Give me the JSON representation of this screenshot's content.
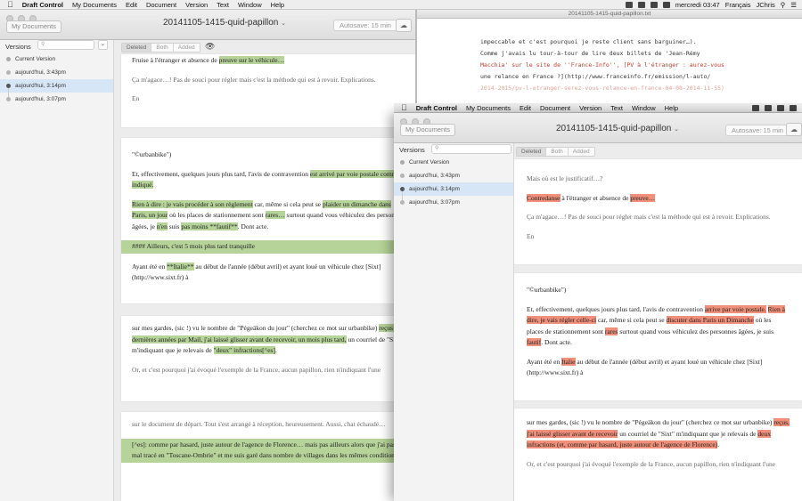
{
  "menubar": {
    "app_name": "Draft Control",
    "items": [
      "My Documents",
      "Edit",
      "Document",
      "Version",
      "Text",
      "Window",
      "Help"
    ],
    "clock": "mercredi 03:47",
    "lang": "Français",
    "user": "JChris"
  },
  "back_window": {
    "toolbar": {
      "my_documents": "My Documents",
      "title": "20141105-1415-quid-papillon",
      "autosave": "Autosave: 15 min"
    },
    "sidebar": {
      "label": "Versions",
      "filter_icon": "chevron-down-icon",
      "items": [
        {
          "label": "Current Version"
        },
        {
          "label": "aujourd'hui, 3:43pm"
        },
        {
          "label": "aujourd'hui, 3:14pm"
        },
        {
          "label": "aujourd'hui, 3:07pm"
        }
      ]
    },
    "segments": [
      "Deleted",
      "Both",
      "Added"
    ],
    "cards": [
      {
        "p1_pre": "Fruise à l'étranger et absence de ",
        "p1_hl": "preuve sur le véhicule…",
        "p2": "Ça m'agace…! Pas de souci pour régler mais c'est la méthode qui est à revoir. Explications.",
        "p3": "En"
      },
      {
        "p1": "\"©urbanbike\")",
        "p2_pre": "Et, effectivement, quelques jours plus tard, l'avis de contravention ",
        "p2_hl": "est arrivé par voie postale comme indiqué.",
        "p3_hl1": "Rien à dire : je vais procéder à son règlement",
        "p3_mid1": " car, même si cela peut se ",
        "p3_hl2": "plaider un dimanche dans Paris, un jour",
        "p3_mid2": " où les places de stationnement sont ",
        "p3_hl3": "rares…",
        "p3_mid3": " surtout quand vous véhiculez des personnes âgées, je ",
        "p3_hl4": "n'en",
        "p3_mid4": " suis ",
        "p3_hl5": "pas moins **fautif**",
        "p3_end": ". Dont acte.",
        "heading": "#### Ailleurs, c'est 5 mois plus tard tranquille",
        "p4_pre": "Ayant été en ",
        "p4_hl": "**Italie**",
        "p4_end": " au début de l'année (début avril) et ayant loué un véhicule chez [Sixt](http://www.sixt.fr) à"
      },
      {
        "p1_pre": "sur mes gardes, (sic !) vu le nombre de \"Pégeäkon du jour\" (cherchez ce mot sur urbanbike) ",
        "p1_hl1": "reçus ces dernières années par Mail, j'ai laissé glisser avant de recevoir, un mois plus tard,",
        "p1_mid": " un courriel de \"Sixt\" m'indiquant que je relevais de ",
        "p1_hl2": "\"deux\" infractions[^es]",
        "p1_end": ".",
        "p2": "Or, et c'est pourquoi j'ai évoqué l'exemple de la France, aucun papillon, rien n'indiquant l'une"
      },
      {
        "p1": "sur le document de départ. Tout s'est arrangé à réception, heureusement. Aussi, chat échaudé…",
        "p2": "[^es]: comme par hasard, juste autour de l'agence de Florence… mais pas ailleurs alors que j'ai pas mal tracé en \"Toscane-Ombrie\" et me suis garé dans nombre de villages dans les mêmes conditions…"
      }
    ]
  },
  "text_window": {
    "title": "20141105-1415-quid-papillon.txt",
    "lines": [
      {
        "text": "impeccable et c'est pourquoi je reste client sans barguiner…)."
      },
      {
        "text": ""
      },
      {
        "text": "Comme j'avais lu tour-à-tour de lire deux billets de 'Jean-Rémy"
      },
      {
        "text": "Macchia' sur le site de ''France-Info'', [PV à l'étranger : aurez-vous"
      },
      {
        "text": "une relance en France ?](http://www.franceinfo.fr/emission/l-auto/"
      },
      {
        "text": "2014-2015/pv-l-etranger-serez-vous-relance-en-france-04-08-2014-11-55)"
      }
    ]
  },
  "front_window": {
    "toolbar": {
      "my_documents": "My Documents",
      "title": "20141105-1415-quid-papillon",
      "autosave": "Autosave: 15 min"
    },
    "sidebar": {
      "label": "Versions",
      "items": [
        {
          "label": "Current Version"
        },
        {
          "label": "aujourd'hui, 3:43pm"
        },
        {
          "label": "aujourd'hui, 3:14pm"
        },
        {
          "label": "aujourd'hui, 3:07pm"
        }
      ]
    },
    "segments": [
      "Deleted",
      "Both",
      "Added"
    ],
    "cards": [
      {
        "p0": "Mais où est le justificatif…?",
        "p1_hl1": "Contredanse",
        "p1_mid": " à l'étranger et absence de ",
        "p1_hl2": "preuve…",
        "p2": "Ça m'agace…! Pas de souci pour régler mais c'est la méthode qui est à revoir. Explications.",
        "p3": "En"
      },
      {
        "p1": "\"©urbanbike\")",
        "p2_pre": "Et, effectivement, quelques jours plus tard, l'avis de contravention ",
        "p2_hl1": "arrive par voie postale.",
        "p2_hl2": "Rien à dire, je vais régler celle-ci",
        "p2_mid1": " car, même si cela peut se ",
        "p2_hl3": "discuter dans Paris un Dimanche",
        "p2_mid2": " où les places de stationnement sont ",
        "p2_hl4": "rares",
        "p2_mid3": " surtout quand vous véhiculez des personnes âgées, je suis ",
        "p2_hl5": "fautif",
        "p2_end": ". Dont acte.",
        "p3_pre": "Ayant été en ",
        "p3_hl": "Italie",
        "p3_end": " au début de l'année (début avril) et ayant loué un véhicule chez [Sixt](http://www.sixt.fr) à"
      },
      {
        "p1_pre": "sur mes gardes, (sic !) vu le nombre de \"Pégeäkon du jour\" (cherchez ce mot sur urbanbike) ",
        "p1_hl1": "reçus, j'ai laissé glisser avant de recevoir",
        "p1_mid": " un courriel de \"Sixt\" m'indiquant que je relevais de ",
        "p1_hl2": "deux infractions (et, comme par hasard, juste autour de l'agence de Florence)",
        "p1_end": ".",
        "p2": "Or, et c'est pourquoi j'ai évoqué l'exemple de la France, aucun papillon, rien n'indiquant l'une"
      }
    ]
  },
  "icons": {
    "eye": "eye-icon",
    "cloud": "cloud-icon",
    "apple": "apple-icon"
  }
}
